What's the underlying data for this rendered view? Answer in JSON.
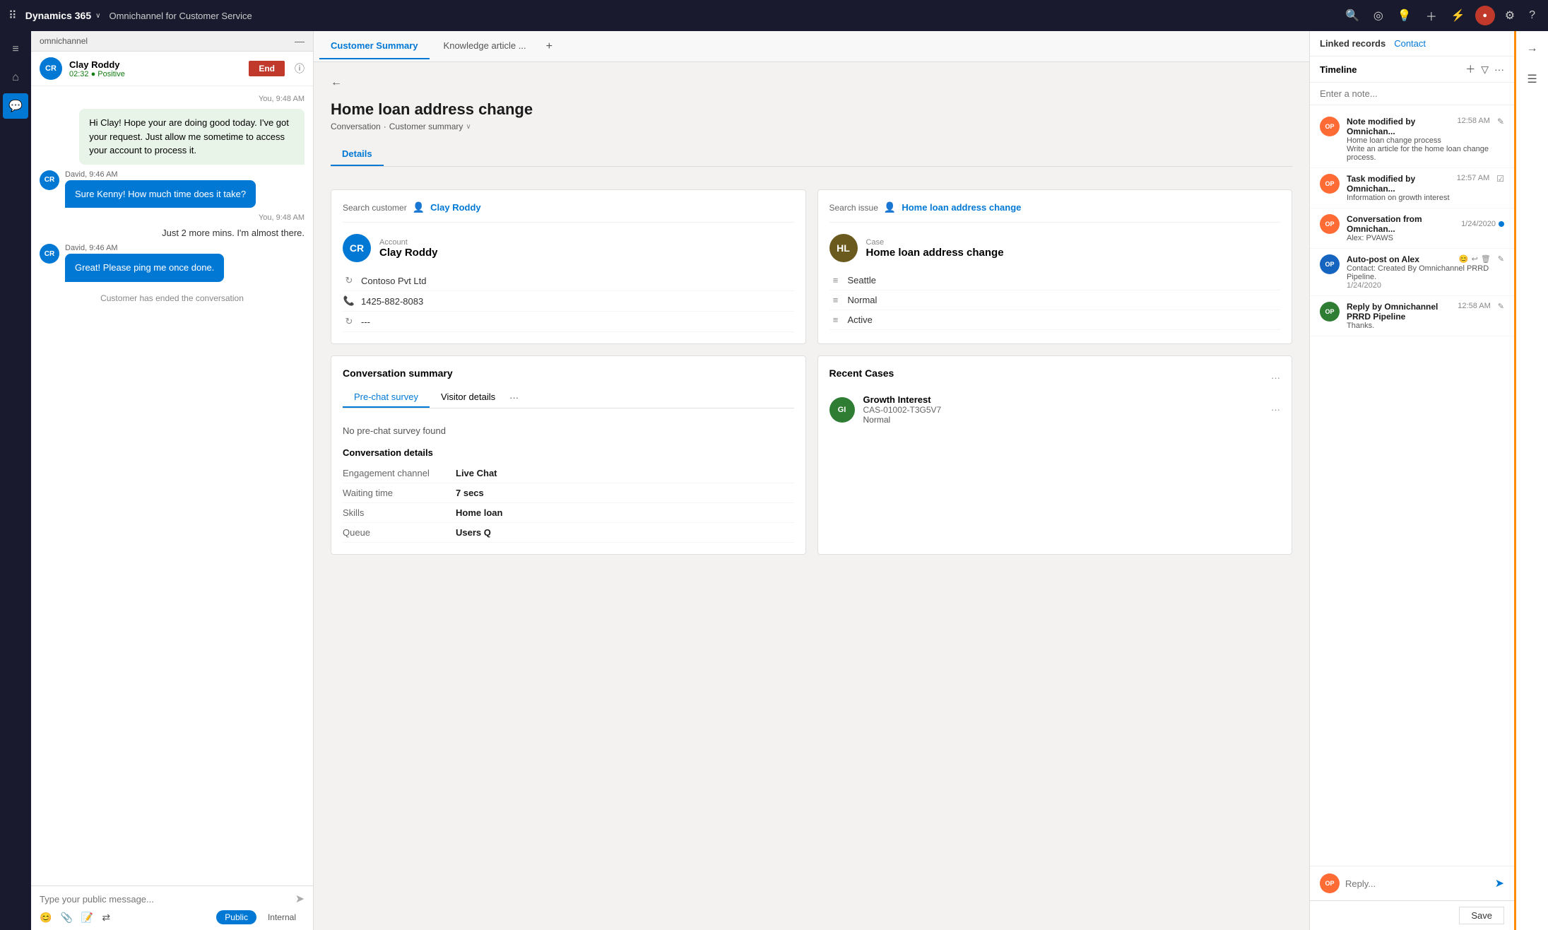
{
  "topNav": {
    "menuIcon": "≡",
    "brandName": "Dynamics 365",
    "brandChevron": "∨",
    "appTitle": "Omnichannel for Customer Service",
    "icons": [
      "🔍",
      "☆",
      "💡",
      "+",
      "⚡",
      "⚙",
      "?"
    ],
    "userInitials": "●"
  },
  "sideIcons": {
    "home": "⌂",
    "chat": "💬"
  },
  "conversationPanel": {
    "headerLabel": "omnichannel",
    "collapseIcon": "—",
    "contact": {
      "initials": "CR",
      "name": "Clay Roddy",
      "time": "02:32",
      "sentiment": "Positive",
      "endBtn": "End"
    },
    "messages": [
      {
        "type": "right",
        "timestamp": "You, 9:48 AM",
        "text": "Hi Clay! Hope your are doing good today. I've got your request. Just allow me sometime to access your account to process it."
      },
      {
        "type": "left",
        "sender": "David, 9:46 AM",
        "initials": "CR",
        "text": "Sure Kenny! How much time does it take?"
      },
      {
        "type": "right",
        "timestamp": "You, 9:48 AM",
        "text": "Just 2 more mins. I'm almost there."
      },
      {
        "type": "left",
        "sender": "David, 9:46 AM",
        "initials": "CR",
        "text": "Great! Please ping me once done."
      },
      {
        "type": "system",
        "text": "Customer has ended the conversation"
      }
    ],
    "inputPlaceholder": "Type your public message...",
    "modes": [
      {
        "label": "Public",
        "active": true
      },
      {
        "label": "Internal",
        "active": false
      }
    ]
  },
  "tabs": [
    {
      "label": "Customer Summary",
      "active": true
    },
    {
      "label": "Knowledge article ...",
      "active": false
    }
  ],
  "tabAddIcon": "+",
  "pageTitle": "Home loan address change",
  "breadcrumb": {
    "parts": [
      "Conversation",
      "·",
      "Customer summary"
    ],
    "chevron": "∨"
  },
  "detailsTab": "Details",
  "customerCard": {
    "searchLabel": "Search customer",
    "searchIcon": "👤",
    "searchValue": "Clay Roddy",
    "avatarInitials": "CR",
    "accountLabel": "Account",
    "customerName": "Clay Roddy",
    "company": "Contoso Pvt Ltd",
    "phone": "1425-882-8083",
    "extra": "---"
  },
  "caseCard": {
    "searchLabel": "Search issue",
    "searchIcon": "👤",
    "searchValue": "Home loan address change",
    "avatarInitials": "HL",
    "caseLabel": "Case",
    "caseName": "Home loan address change",
    "location": "Seattle",
    "priority": "Normal",
    "status": "Active"
  },
  "conversationSummary": {
    "title": "Conversation summary",
    "tabs": [
      "Pre-chat survey",
      "Visitor details"
    ],
    "moreIcon": "···",
    "noSurvey": "No pre-chat survey found",
    "detailsTitle": "Conversation details",
    "details": [
      {
        "label": "Engagement channel",
        "value": "Live Chat"
      },
      {
        "label": "Waiting time",
        "value": "7 secs"
      },
      {
        "label": "Skills",
        "value": "Home loan"
      },
      {
        "label": "Queue",
        "value": "Users Q"
      }
    ]
  },
  "recentCases": {
    "title": "Recent Cases",
    "moreIcon": "···",
    "cases": [
      {
        "initials": "GI",
        "name": "Growth Interest",
        "id": "CAS-01002-T3G5V7",
        "priority": "Normal"
      }
    ]
  },
  "linkedRecords": {
    "title": "Linked records",
    "contactLabel": "Contact",
    "timeline": {
      "title": "Timeline",
      "notePlaceholder": "Enter a note...",
      "items": [
        {
          "avatarType": "op",
          "initials": "OP",
          "title": "Note modified by Omnichan...",
          "subtitle": "Home loan change process",
          "description": "Write an article for the home loan change process.",
          "time": "12:58 AM"
        },
        {
          "avatarType": "op",
          "initials": "OP",
          "title": "Task modified by Omnichan...",
          "subtitle": "Information on growth interest",
          "time": "12:57 AM"
        },
        {
          "avatarType": "op",
          "initials": "OP",
          "title": "Conversation from Omnichan...",
          "subtitle": "Alex: PVAWS",
          "time": "1/24/2020",
          "badgeColor": "blue"
        },
        {
          "avatarType": "blue",
          "initials": "OP",
          "title": "Auto-post on Alex",
          "subtitle": "Contact: Created By Omnichannel PRRD Pipeline.",
          "time": "1/24/2020"
        },
        {
          "avatarType": "op",
          "initials": "OP",
          "title": "Reply by Omnichannel PRRD Pipeline",
          "subtitle": "Thanks.",
          "time": "12:58 AM"
        }
      ],
      "replyPlaceholder": "Reply..."
    }
  },
  "saveBtn": "Save"
}
